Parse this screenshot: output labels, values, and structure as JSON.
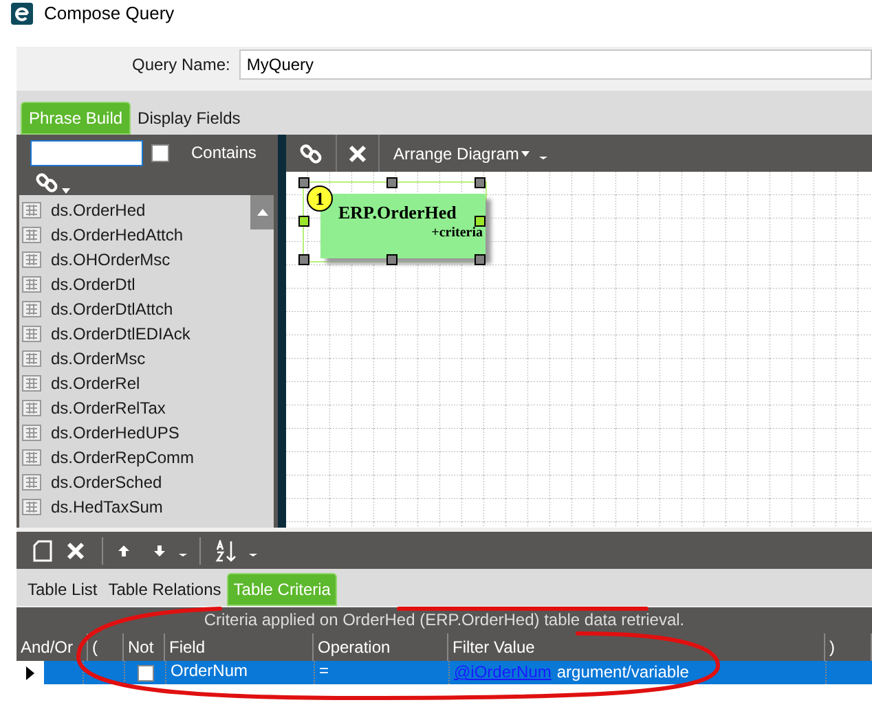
{
  "window": {
    "title": "Compose Query"
  },
  "query_name": {
    "label": "Query Name:",
    "value": "MyQuery"
  },
  "tabs": [
    {
      "label": "Phrase Build",
      "selected": true
    },
    {
      "label": "Display Fields",
      "selected": false
    }
  ],
  "table_filter": {
    "contains_label": "Contains",
    "checked": false
  },
  "tables": [
    "ds.OrderHed",
    "ds.OrderHedAttch",
    "ds.OHOrderMsc",
    "ds.OrderDtl",
    "ds.OrderDtlAttch",
    "ds.OrderDtlEDIAck",
    "ds.OrderMsc",
    "ds.OrderRel",
    "ds.OrderRelTax",
    "ds.OrderHedUPS",
    "ds.OrderRepComm",
    "ds.OrderSched",
    "ds.HedTaxSum"
  ],
  "diagram_toolbar": {
    "arrange_label": "Arrange Diagram"
  },
  "nodes": [
    {
      "number": "1",
      "name": "ERP.OrderHed",
      "note": "+criteria",
      "selected": true
    }
  ],
  "bottom_tabs": [
    {
      "label": "Table List",
      "selected": false
    },
    {
      "label": "Table Relations",
      "selected": false
    },
    {
      "label": "Table Criteria",
      "selected": true
    }
  ],
  "criteria": {
    "caption": "Criteria applied on OrderHed (ERP.OrderHed)  table data retrieval.",
    "columns": [
      "And/Or",
      "(",
      "Not",
      "Field",
      "Operation",
      "Filter Value",
      ")"
    ],
    "rows": [
      {
        "field": "OrderNum",
        "operation": "=",
        "filter_link": "@iOrderNum",
        "filter_text": "argument/variable",
        "not": false,
        "selected": true
      }
    ]
  }
}
